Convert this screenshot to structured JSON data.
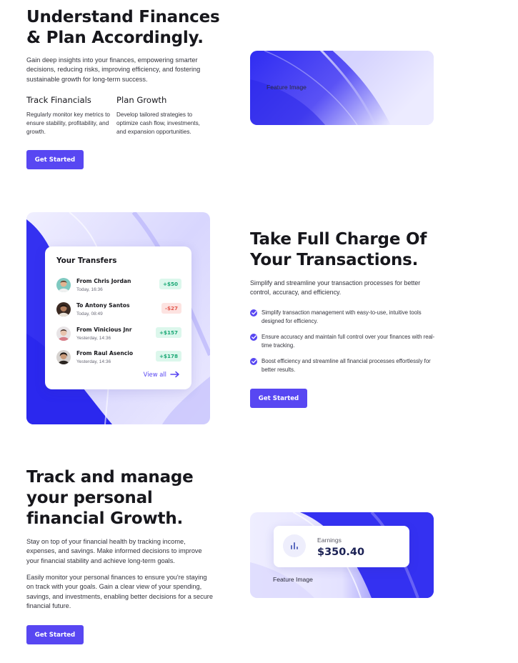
{
  "colors": {
    "accent": "#5847f2",
    "brand_blue": "#3a33f0",
    "positive": "#19a774",
    "negative": "#e2574c"
  },
  "section1": {
    "title_line1": "Understand Finances",
    "title_line2": "& Plan Accordingly.",
    "description": "Gain deep insights into your finances, empowering smarter decisions, reducing risks, improving efficiency, and fostering sustainable growth for long-term success.",
    "features": [
      {
        "title": "Track Financials",
        "description": "Regularly monitor key metrics to ensure stability, profitability, and growth."
      },
      {
        "title": "Plan Growth",
        "description": "Develop tailored strategies to optimize cash flow, investments, and expansion opportunities."
      }
    ],
    "button_label": "Get Started",
    "image_label": "Feature Image"
  },
  "section2": {
    "title_line1": "Take Full Charge Of",
    "title_line2": "Your Transactions.",
    "description": "Simplify and streamline your transaction processes for better control, accuracy, and efficiency.",
    "checklist": [
      "Simplify transaction management with easy-to-use, intuitive tools designed for efficiency.",
      "Ensure accuracy and maintain full control over your finances with real-time tracking.",
      "Boost efficiency and streamline all financial processes effortlessly for better results."
    ],
    "button_label": "Get Started",
    "transfers": {
      "title": "Your Transfers",
      "items": [
        {
          "name": "From Chris Jordan",
          "time": "Today, 16:36",
          "amount": "+$50",
          "direction": "positive",
          "avatar_color": "#c9a27c"
        },
        {
          "name": "To Antony Santos",
          "time": "Today, 08:49",
          "amount": "-$27",
          "direction": "negative",
          "avatar_color": "#5a3d2e"
        },
        {
          "name": "From Vinicious Jnr",
          "time": "Yesterday, 14:36",
          "amount": "+$157",
          "direction": "positive",
          "avatar_color": "#d9b8a6"
        },
        {
          "name": "From Raul Asencio",
          "time": "Yesterday, 14:36",
          "amount": "+$178",
          "direction": "positive",
          "avatar_color": "#2d2622"
        }
      ],
      "view_all_label": "View all"
    }
  },
  "section3": {
    "title_line1": "Track and manage",
    "title_line2": "your personal",
    "title_line3": "financial Growth.",
    "paragraph1": "Stay on top of your financial health by tracking income, expenses, and savings. Make informed decisions to improve your financial stability and achieve long-term goals.",
    "paragraph2": "Easily monitor your personal finances to ensure you're staying on track with your goals. Gain a clear view of your spending, savings, and investments, enabling better decisions for a secure financial future.",
    "button_label": "Get Started",
    "image_label": "Feature Image",
    "earnings": {
      "label": "Earnings",
      "value": "$350.40",
      "icon": "bar-chart-icon"
    }
  }
}
